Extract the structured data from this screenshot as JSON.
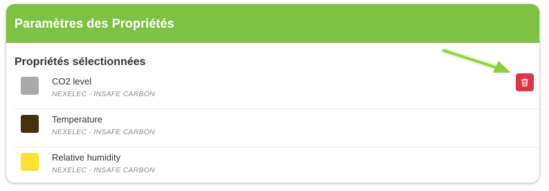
{
  "panel": {
    "title": "Paramètres des Propriétés",
    "header_color": "#7dc243",
    "section_title": "Propriétés sélectionnées"
  },
  "properties": [
    {
      "name": "CO2 level",
      "device": "NEXELEC - INSAFE CARBON",
      "color": "#aaaaaa"
    },
    {
      "name": "Temperature",
      "device": "NEXELEC - INSAFE CARBON",
      "color": "#45300f"
    },
    {
      "name": "Relative humidity",
      "device": "NEXELEC - INSAFE CARBON",
      "color": "#ffe033"
    }
  ],
  "delete_button": {
    "icon": "trash-icon",
    "color": "#dc3545"
  },
  "annotation": {
    "arrow_color": "#8fd03a"
  }
}
